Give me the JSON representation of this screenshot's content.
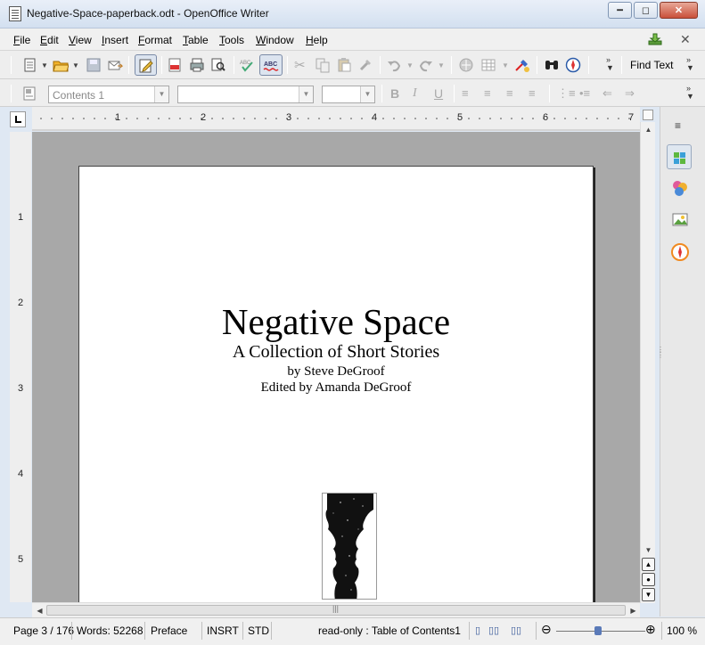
{
  "window": {
    "title": "Negative-Space-paperback.odt - OpenOffice Writer"
  },
  "menu": {
    "items": [
      "File",
      "Edit",
      "View",
      "Insert",
      "Format",
      "Table",
      "Tools",
      "Window",
      "Help"
    ]
  },
  "toolbar": {
    "find_text": "Find Text"
  },
  "formatting": {
    "paragraph_style": "Contents 1",
    "font_name": "",
    "font_size": ""
  },
  "ruler": {
    "h_marks": [
      "1",
      "2",
      "3",
      "4",
      "5",
      "6",
      "7"
    ],
    "v_marks": [
      "1",
      "2",
      "3",
      "4",
      "5"
    ]
  },
  "document": {
    "title": "Negative Space",
    "subtitle": "A Collection of Short Stories",
    "author": "by Steve DeGroof",
    "editor": "Edited by Amanda DeGroof"
  },
  "status": {
    "page": "Page 3 / 176",
    "words": "Words: 52268",
    "page_style": "Preface",
    "insert_mode": "INSRT",
    "selection_mode": "STD",
    "section": "read-only : Table of Contents1",
    "zoom": "100 %"
  },
  "icons": [
    "app-document-icon",
    "minimize-icon",
    "maximize-icon",
    "close-icon",
    "download-update-icon",
    "new-icon",
    "open-icon",
    "save-icon",
    "email-icon",
    "edit-file-icon",
    "export-pdf-icon",
    "print-icon",
    "page-preview-icon",
    "spellcheck-icon",
    "autospellcheck-icon",
    "cut-icon",
    "copy-icon",
    "paste-icon",
    "clone-formatting-icon",
    "undo-icon",
    "redo-icon",
    "hyperlink-icon",
    "table-icon",
    "draw-functions-icon",
    "find-replace-icon",
    "navigator-icon",
    "properties-icon",
    "styles-icon",
    "gallery-icon"
  ]
}
